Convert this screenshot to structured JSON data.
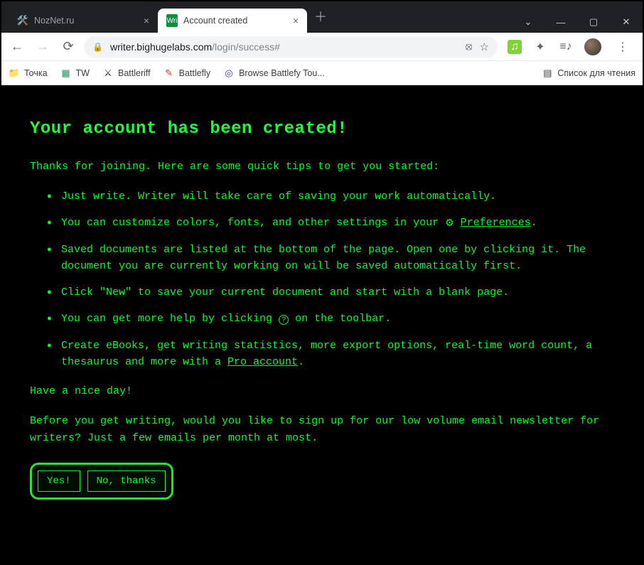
{
  "window": {
    "tabs": [
      {
        "title": "NozNet.ru",
        "favicon": "🛠️"
      },
      {
        "title": "Account created",
        "favicon": "Wri"
      }
    ]
  },
  "toolbar": {
    "url_host": "writer.bighugelabs.com",
    "url_path": "/login/success#"
  },
  "bookmarks": {
    "items": [
      {
        "label": "Точка",
        "icon": "📁",
        "color": "#f4b400"
      },
      {
        "label": "TW",
        "icon": "▦",
        "color": "#0f9d58"
      },
      {
        "label": "Battleriff",
        "icon": "⚔",
        "color": "#202124"
      },
      {
        "label": "Battlefly",
        "icon": "✎",
        "color": "#d93025"
      },
      {
        "label": "Browse Battlefy Tou...",
        "icon": "◎",
        "color": "#4a3a8a"
      }
    ],
    "reading_list": "Список для чтения"
  },
  "page": {
    "heading": "Your account has been created!",
    "intro": "Thanks for joining. Here are some quick tips to get you started:",
    "tips": {
      "t1": "Just write. Writer will take care of saving your work automatically.",
      "t2a": "You can customize colors, fonts, and other settings in your ",
      "t2_link": "Preferences",
      "t2b": ".",
      "t3": "Saved documents are listed at the bottom of the page. Open one by clicking it. The document you are currently working on will be saved automatically first.",
      "t4": "Click \"New\" to save your current document and start with a blank page.",
      "t5a": "You can get more help by clicking ",
      "t5b": " on the toolbar.",
      "t6a": "Create eBooks, get writing statistics, more export options, real-time word count, a thesaurus and more with a ",
      "t6_link": "Pro account",
      "t6b": "."
    },
    "outro": "Have a nice day!",
    "newsletter_prompt": "Before you get writing, would you like to sign up for our low volume email newsletter for writers? Just a few emails per month at most.",
    "yes_label": "Yes!",
    "no_label": "No, thanks"
  }
}
